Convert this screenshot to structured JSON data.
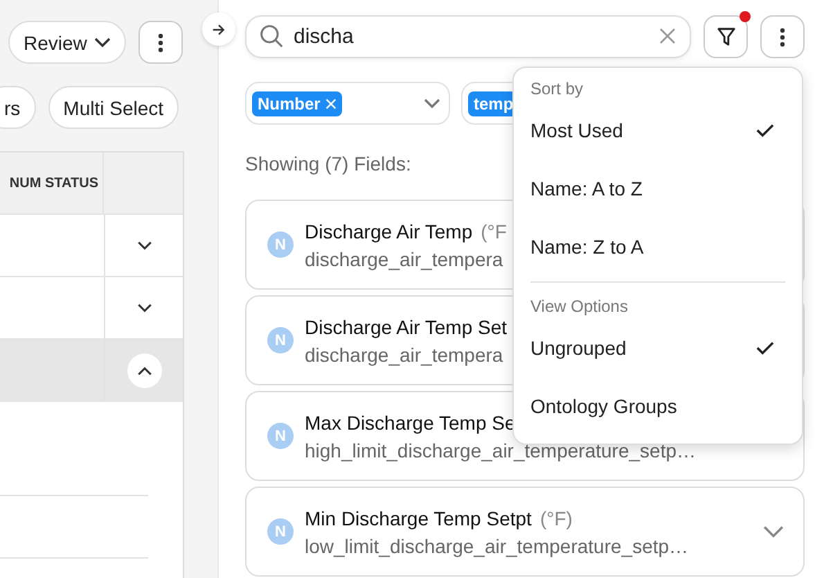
{
  "left_panel": {
    "toolbar": {
      "review_button": "Review",
      "partial_button": "rs",
      "multi_select_button": "Multi Select"
    },
    "table": {
      "columns": [
        "NUM STATUS"
      ],
      "rows": [
        {
          "expanded": false
        },
        {
          "expanded": false
        },
        {
          "expanded": true
        }
      ]
    }
  },
  "search": {
    "value": "discha"
  },
  "filter_button": {
    "has_indicator": true
  },
  "filters": [
    {
      "chips": [
        "Number"
      ]
    },
    {
      "chips": [
        "temp"
      ]
    }
  ],
  "result_count": "Showing (7) Fields:",
  "fields": [
    {
      "badge": "N",
      "name": "Discharge Air Temp",
      "unit": "(°F",
      "key": "discharge_air_tempera"
    },
    {
      "badge": "N",
      "name": "Discharge Air Temp Set",
      "key": "discharge_air_tempera"
    },
    {
      "badge": "N",
      "name": "Max Discharge Temp Se",
      "key": "high_limit_discharge_air_temperature_setp…"
    },
    {
      "badge": "N",
      "name": "Min Discharge Temp Setpt",
      "unit": "(°F)",
      "key": "low_limit_discharge_air_temperature_setp…",
      "chevron": true
    }
  ],
  "menu": {
    "sections": [
      {
        "title": "Sort by",
        "options": [
          {
            "label": "Most Used",
            "selected": true
          },
          {
            "label": "Name: A to Z",
            "selected": false
          },
          {
            "label": "Name: Z to A",
            "selected": false
          }
        ]
      },
      {
        "title": "View Options",
        "options": [
          {
            "label": "Ungrouped",
            "selected": true
          },
          {
            "label": "Ontology Groups",
            "selected": false
          }
        ]
      }
    ]
  }
}
